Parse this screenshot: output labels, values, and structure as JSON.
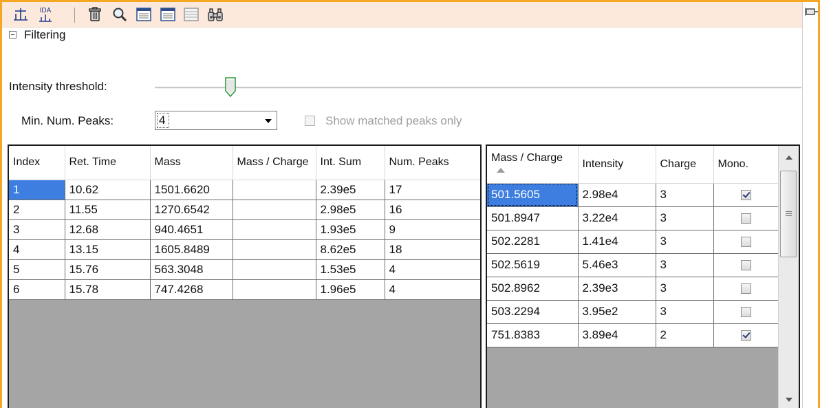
{
  "toolbar": {
    "icons": [
      "spectrum-peak-icon",
      "ida-spectrum-icon",
      "delete-icon",
      "search-icon",
      "table-view-icon",
      "table-view-2-icon",
      "table-view-disabled-icon",
      "binoculars-icon"
    ],
    "ida_label": "IDA"
  },
  "filtering": {
    "section_label": "Filtering",
    "intensity_label": "Intensity threshold:",
    "intensity_slider_fraction": 0.12,
    "min_peaks_label": "Min. Num. Peaks:",
    "min_peaks_value": "4",
    "show_matched_label": "Show matched peaks only",
    "show_matched_checked": false,
    "show_matched_enabled": false
  },
  "left_table": {
    "headers": [
      "Index",
      "Ret. Time",
      "Mass",
      "Mass / Charge",
      "Int. Sum",
      "Num. Peaks"
    ],
    "rows": [
      [
        "1",
        "10.62",
        "1501.6620",
        "",
        "2.39e5",
        "17"
      ],
      [
        "2",
        "11.55",
        "1270.6542",
        "",
        "2.98e5",
        "16"
      ],
      [
        "3",
        "12.68",
        "940.4651",
        "",
        "1.93e5",
        "9"
      ],
      [
        "4",
        "13.15",
        "1605.8489",
        "",
        "8.62e5",
        "18"
      ],
      [
        "5",
        "15.76",
        "563.3048",
        "",
        "1.53e5",
        "4"
      ],
      [
        "6",
        "15.78",
        "747.4268",
        "",
        "1.96e5",
        "4"
      ]
    ],
    "selected_row": 0
  },
  "right_table": {
    "headers": [
      "Mass / Charge",
      "Intensity",
      "Charge",
      "Mono."
    ],
    "sorted_column": "Mass / Charge",
    "rows": [
      {
        "mz": "501.5605",
        "intensity": "2.98e4",
        "charge": "3",
        "mono": true
      },
      {
        "mz": "501.8947",
        "intensity": "3.22e4",
        "charge": "3",
        "mono": false
      },
      {
        "mz": "502.2281",
        "intensity": "1.41e4",
        "charge": "3",
        "mono": false
      },
      {
        "mz": "502.5619",
        "intensity": "5.46e3",
        "charge": "3",
        "mono": false
      },
      {
        "mz": "502.8962",
        "intensity": "2.39e3",
        "charge": "3",
        "mono": false
      },
      {
        "mz": "503.2294",
        "intensity": "3.95e2",
        "charge": "3",
        "mono": false
      },
      {
        "mz": "751.8383",
        "intensity": "3.89e4",
        "charge": "2",
        "mono": true
      }
    ]
  },
  "colors": {
    "frame_accent": "#f5a623",
    "toolbar_bg": "#fce9dc",
    "selection": "#3d7ee0",
    "empty_grid": "#a5a5a5"
  }
}
